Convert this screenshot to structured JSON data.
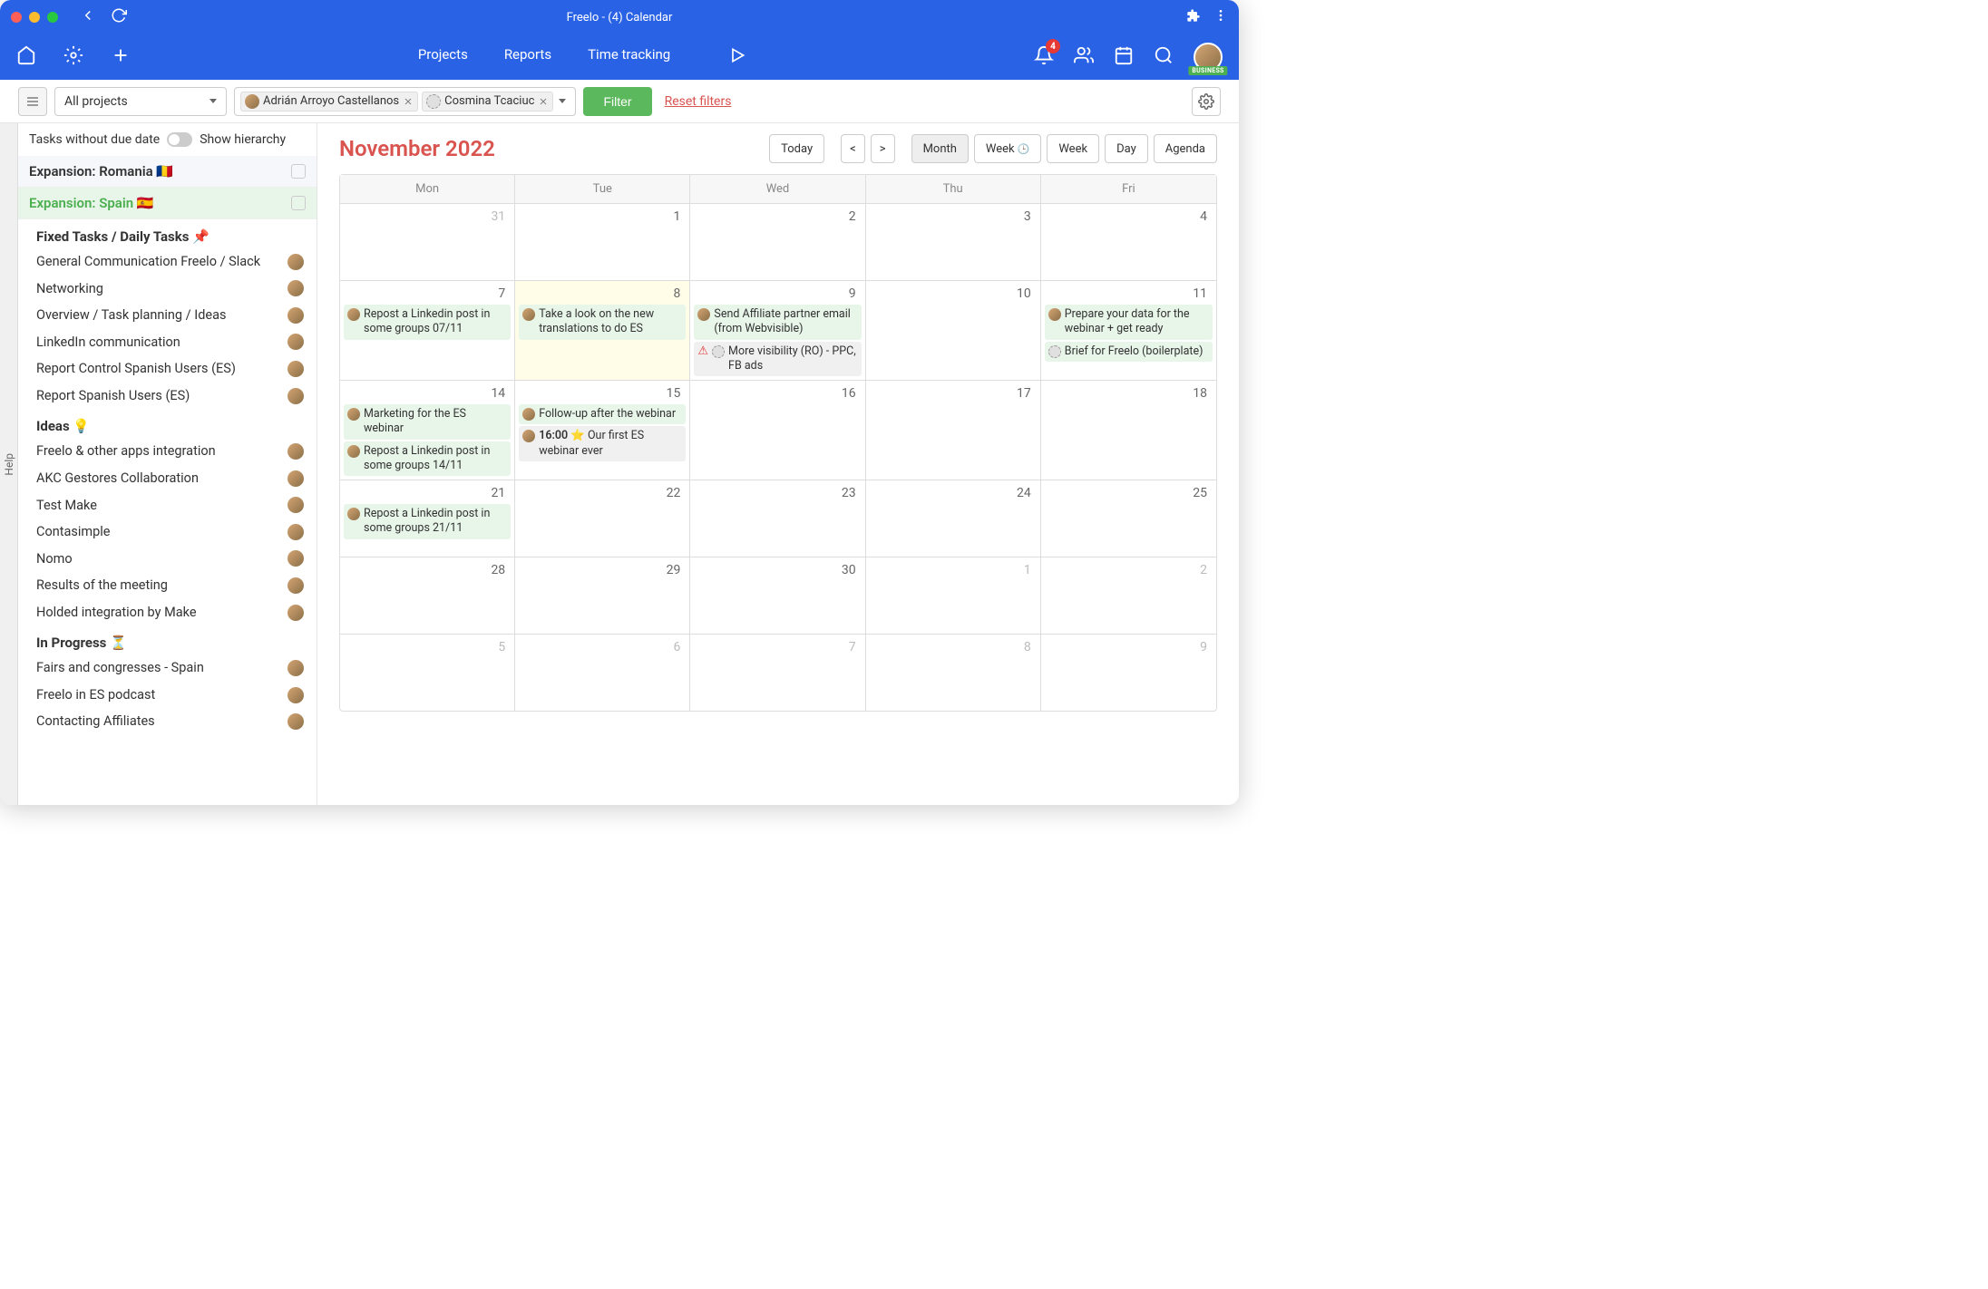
{
  "window": {
    "title": "Freelo - (4) Calendar"
  },
  "nav": {
    "projects": "Projects",
    "reports": "Reports",
    "time_tracking": "Time tracking",
    "notif_count": "4",
    "user_badge": "BUSINESS"
  },
  "filterbar": {
    "projects_dropdown": "All projects",
    "person1": "Adrián Arroyo Castellanos",
    "person2": "Cosmina Tcaciuc",
    "filter_btn": "Filter",
    "reset": "Reset filters"
  },
  "sidebar": {
    "no_due": "Tasks without due date",
    "show_hierarchy": "Show hierarchy",
    "project_romania": "Expansion: Romania 🇷🇴",
    "project_spain": "Expansion: Spain 🇪🇸",
    "sections": [
      {
        "title": "Fixed Tasks / Daily Tasks 📌",
        "tasks": [
          "General Communication Freelo / Slack",
          "Networking",
          "Overview / Task planning / Ideas",
          "LinkedIn communication",
          "Report Control Spanish Users (ES)",
          "Report Spanish Users (ES)"
        ]
      },
      {
        "title": "Ideas 💡",
        "tasks": [
          "Freelo & other apps integration",
          "AKC Gestores Collaboration",
          "Test Make",
          "Contasimple",
          "Nomo",
          "Results of the meeting",
          "Holded integration by Make"
        ]
      },
      {
        "title": "In Progress ⏳",
        "tasks": [
          "Fairs and congresses - Spain",
          "Freelo in ES podcast",
          "Contacting Affiliates"
        ]
      }
    ]
  },
  "calendar": {
    "title": "November 2022",
    "today": "Today",
    "views": {
      "month": "Month",
      "week1": "Week",
      "week2": "Week",
      "day": "Day",
      "agenda": "Agenda"
    },
    "days": [
      "Mon",
      "Tue",
      "Wed",
      "Thu",
      "Fri"
    ],
    "weeks": [
      {
        "row": "first-row",
        "cells": [
          {
            "d": "31",
            "outside": true
          },
          {
            "d": "1"
          },
          {
            "d": "2"
          },
          {
            "d": "3"
          },
          {
            "d": "4"
          }
        ]
      },
      {
        "cells": [
          {
            "d": "7",
            "events": [
              {
                "cls": "green",
                "avatar": "normal",
                "text": "Repost a Linkedin post in some groups 07/11"
              }
            ]
          },
          {
            "d": "8",
            "today": true,
            "events": [
              {
                "cls": "green",
                "avatar": "normal",
                "text": "Take a look on the new translations to do ES"
              }
            ]
          },
          {
            "d": "9",
            "events": [
              {
                "cls": "green",
                "avatar": "normal",
                "text": "Send Affiliate partner email (from Webvisible)"
              },
              {
                "cls": "grey",
                "avatar": "ghost",
                "warn": true,
                "text": "More visibility (RO) - PPC, FB ads"
              }
            ]
          },
          {
            "d": "10"
          },
          {
            "d": "11",
            "events": [
              {
                "cls": "green",
                "avatar": "normal",
                "text": "Prepare your data for the webinar + get ready"
              },
              {
                "cls": "green",
                "avatar": "ghost",
                "text": "Brief for Freelo (boilerplate)"
              }
            ]
          }
        ]
      },
      {
        "cells": [
          {
            "d": "14",
            "events": [
              {
                "cls": "green",
                "avatar": "normal",
                "text": "Marketing for the ES webinar"
              },
              {
                "cls": "green",
                "avatar": "normal",
                "text": "Repost a Linkedin post in some groups 14/11"
              }
            ]
          },
          {
            "d": "15",
            "events": [
              {
                "cls": "green",
                "avatar": "normal",
                "text": "Follow-up after the webinar"
              },
              {
                "cls": "grey",
                "avatar": "normal",
                "time": "16:00",
                "star": true,
                "text": "Our first ES webinar ever"
              }
            ]
          },
          {
            "d": "16"
          },
          {
            "d": "17"
          },
          {
            "d": "18"
          }
        ]
      },
      {
        "cells": [
          {
            "d": "21",
            "events": [
              {
                "cls": "green",
                "avatar": "normal",
                "text": "Repost a Linkedin post in some groups 21/11"
              }
            ]
          },
          {
            "d": "22"
          },
          {
            "d": "23"
          },
          {
            "d": "24"
          },
          {
            "d": "25"
          }
        ]
      },
      {
        "cells": [
          {
            "d": "28"
          },
          {
            "d": "29"
          },
          {
            "d": "30"
          },
          {
            "d": "1",
            "outside": true
          },
          {
            "d": "2",
            "outside": true
          }
        ]
      },
      {
        "cells": [
          {
            "d": "5",
            "outside": true
          },
          {
            "d": "6",
            "outside": true
          },
          {
            "d": "7",
            "outside": true
          },
          {
            "d": "8",
            "outside": true
          },
          {
            "d": "9",
            "outside": true
          }
        ]
      }
    ]
  },
  "help_label": "Help"
}
